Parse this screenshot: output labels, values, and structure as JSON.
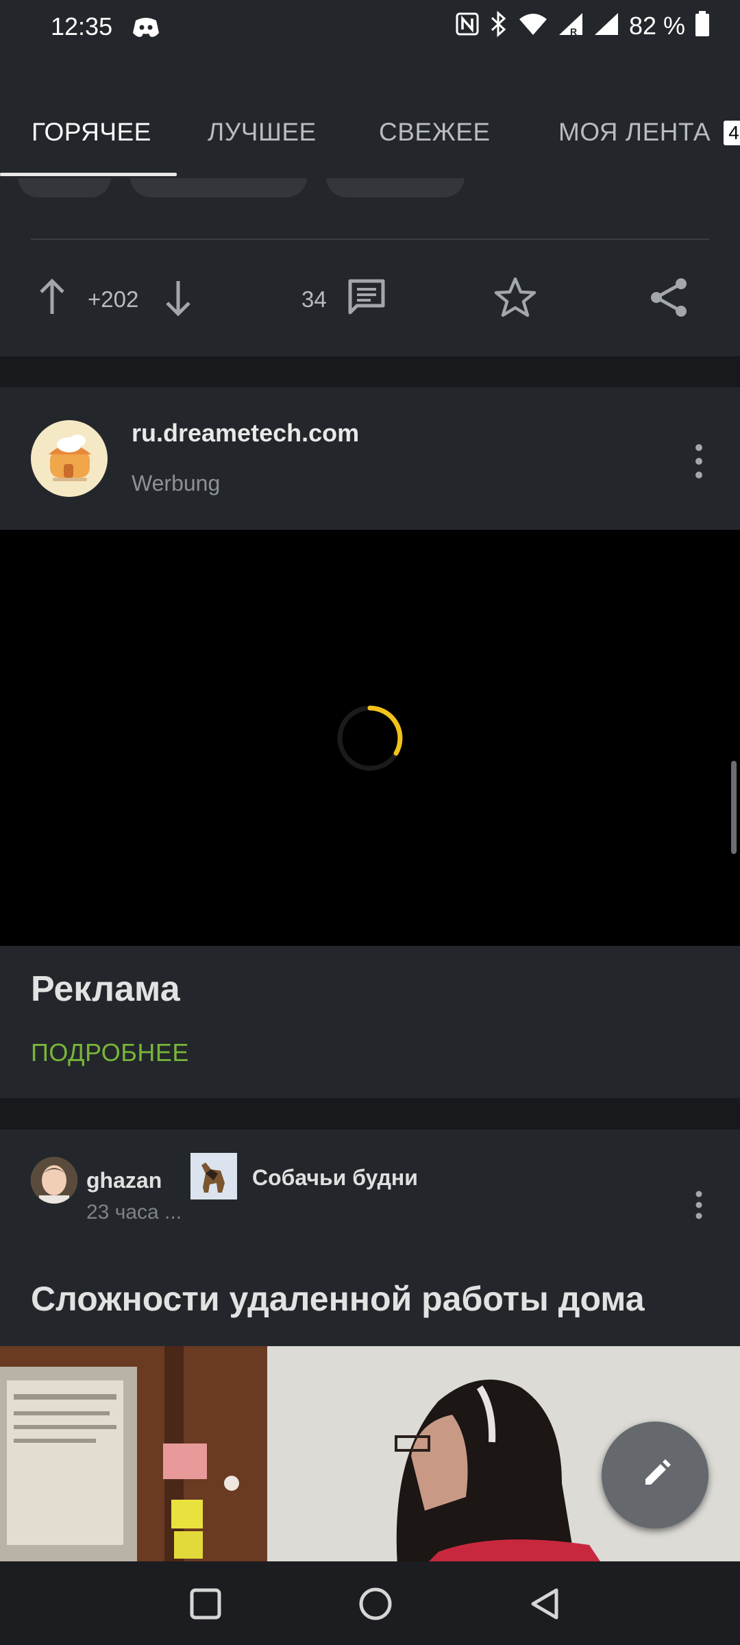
{
  "status_bar": {
    "time": "12:35",
    "battery": "82 %",
    "icons": [
      "discord-icon",
      "nfc-icon",
      "bluetooth-icon",
      "wifi-icon",
      "signal-roaming-icon",
      "signal-icon",
      "battery-icon"
    ]
  },
  "tabs": [
    {
      "label": "ГОРЯЧЕЕ",
      "active": true
    },
    {
      "label": "ЛУЧШЕЕ",
      "active": false
    },
    {
      "label": "СВЕЖЕЕ",
      "active": false
    },
    {
      "label": "МОЯ ЛЕНТА",
      "active": false
    }
  ],
  "tab_badge": "4",
  "previous_post": {
    "score": "+202",
    "comments": "34"
  },
  "ad": {
    "domain": "ru.dreametech.com",
    "label": "Werbung",
    "title": "Реклама",
    "more_link": "ПОДРОБНЕЕ"
  },
  "post": {
    "author": "ghazan",
    "time": "23 часа ...",
    "community": "Собачьи будни",
    "title": "Сложности удаленной работы дома"
  },
  "colors": {
    "background": "#17191c",
    "card": "#23272b",
    "accent_green": "#79b53a",
    "spinner": "#f2c21a",
    "fab": "#65686c"
  }
}
